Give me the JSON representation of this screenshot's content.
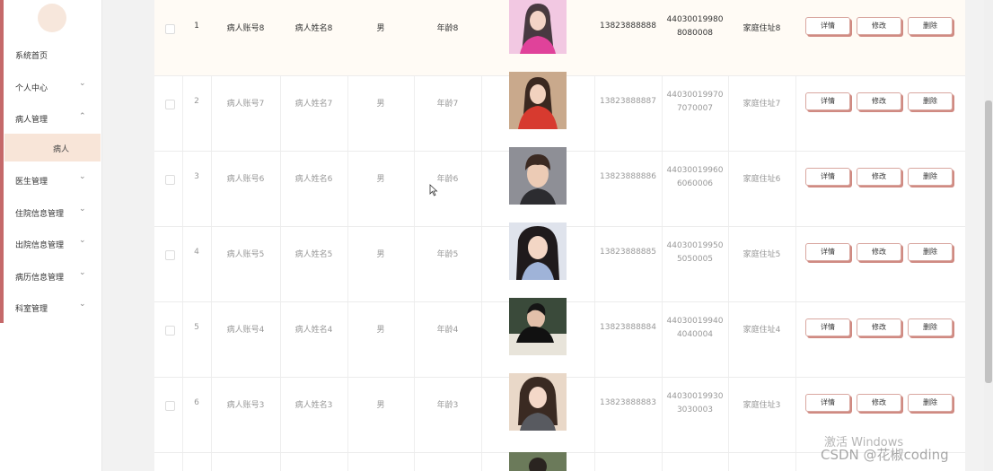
{
  "sidebar": {
    "items": [
      {
        "label": "系统首页",
        "has_chevron": false
      },
      {
        "label": "个人中心",
        "has_chevron": true,
        "chevron": "⌄"
      },
      {
        "label": "病人管理",
        "has_chevron": true,
        "chevron": "⌃"
      },
      {
        "label": "医生管理",
        "has_chevron": true,
        "chevron": "⌄"
      },
      {
        "label": "住院信息管理",
        "has_chevron": true,
        "chevron": "⌄"
      },
      {
        "label": "出院信息管理",
        "has_chevron": true,
        "chevron": "⌄"
      },
      {
        "label": "病历信息管理",
        "has_chevron": true,
        "chevron": "⌄"
      },
      {
        "label": "科室管理",
        "has_chevron": true,
        "chevron": "⌄"
      }
    ],
    "active_sub_item": "病人",
    "accent_color": "#c5696a"
  },
  "table": {
    "rows": [
      {
        "index": "1",
        "account": "病人账号8",
        "name": "病人姓名8",
        "gender": "男",
        "age": "年龄8",
        "photo": "portrait-pink",
        "phone": "13823888888",
        "id_line1": "44030019980",
        "id_line2": "8080008",
        "address": "家庭住址8"
      },
      {
        "index": "2",
        "account": "病人账号7",
        "name": "病人姓名7",
        "gender": "男",
        "age": "年龄7",
        "photo": "portrait-red",
        "phone": "13823888887",
        "id_line1": "44030019970",
        "id_line2": "7070007",
        "address": "家庭住址7"
      },
      {
        "index": "3",
        "account": "病人账号6",
        "name": "病人姓名6",
        "gender": "男",
        "age": "年龄6",
        "photo": "portrait-man",
        "phone": "13823888886",
        "id_line1": "44030019960",
        "id_line2": "6060006",
        "address": "家庭住址6"
      },
      {
        "index": "4",
        "account": "病人账号5",
        "name": "病人姓名5",
        "gender": "男",
        "age": "年龄5",
        "photo": "portrait-woman-blue",
        "phone": "13823888885",
        "id_line1": "44030019950",
        "id_line2": "5050005",
        "address": "家庭住址5"
      },
      {
        "index": "5",
        "account": "病人账号4",
        "name": "病人姓名4",
        "gender": "男",
        "age": "年龄4",
        "photo": "portrait-man-reading",
        "phone": "13823888884",
        "id_line1": "44030019940",
        "id_line2": "4040004",
        "address": "家庭住址4"
      },
      {
        "index": "6",
        "account": "病人账号3",
        "name": "病人姓名3",
        "gender": "男",
        "age": "年龄3",
        "photo": "portrait-woman-gray",
        "phone": "13823888883",
        "id_line1": "44030019930",
        "id_line2": "3030003",
        "address": "家庭住址3"
      }
    ],
    "actions": {
      "detail": "详情",
      "edit": "修改",
      "delete": "删除"
    }
  },
  "watermarks": {
    "activate": "激活 Windows",
    "csdn": "CSDN @花椒coding"
  },
  "colors": {
    "button_shadow": "#d08a82",
    "active_sub_bg": "#f8e5d8",
    "first_row_bg": "#fffbf5"
  }
}
